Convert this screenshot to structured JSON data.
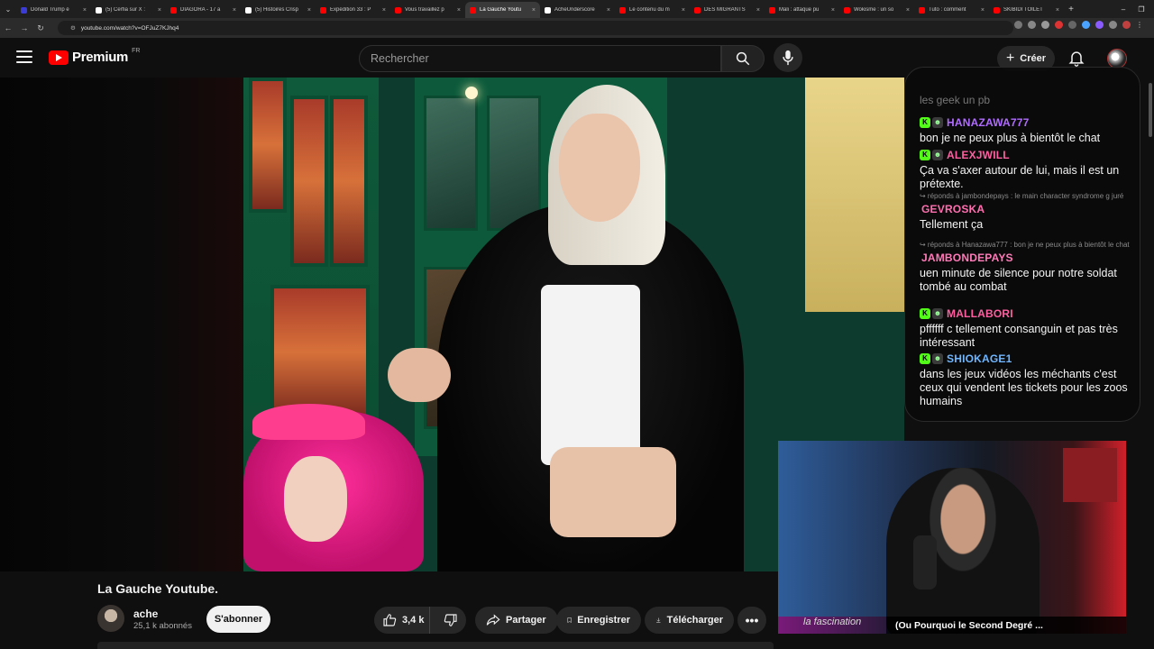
{
  "browser": {
    "tabs": [
      {
        "title": "Donald Trump é",
        "color": "#3b3bd6"
      },
      {
        "title": "(5) Cerfia sur X :",
        "color": "#ffffff"
      },
      {
        "title": "DIAGORA - 17 a",
        "color": "#ff0000"
      },
      {
        "title": "(5) Histoires Crisp",
        "color": "#ffffff"
      },
      {
        "title": "Expédition 33 : P",
        "color": "#ff0000"
      },
      {
        "title": "Vous travaillez p",
        "color": "#ff0000"
      },
      {
        "title": "La Gauche Youtu",
        "color": "#ff0000"
      },
      {
        "title": "AcheUnderscore",
        "color": "#ffffff"
      },
      {
        "title": "Le contenu du m",
        "color": "#ff0000"
      },
      {
        "title": "DES MIGRANTS",
        "color": "#ff0000"
      },
      {
        "title": "Mali : attaque pu",
        "color": "#ff0000"
      },
      {
        "title": "Wokisme : un so",
        "color": "#ff0000"
      },
      {
        "title": "Tuto : comment",
        "color": "#ff0000"
      },
      {
        "title": "SKIBIDI TOILET",
        "color": "#ff0000"
      }
    ],
    "active_tab": 6,
    "url": "youtube.com/watch?v=OFJuZ7KJhq4"
  },
  "header": {
    "logo_text": "Premium",
    "country": "FR",
    "search_placeholder": "Rechercher",
    "create_label": "Créer"
  },
  "chat": {
    "top_fragment": "les geek un pb",
    "messages": [
      {
        "user": "HANAZAWA777",
        "color": "#b06cff",
        "badges": true,
        "reply": "",
        "text": "bon je ne peux plus à bientôt le chat"
      },
      {
        "user": "ALEXJWILL",
        "color": "#ff5fa0",
        "badges": true,
        "reply": "",
        "text": "Ça va s'axer autour de lui, mais il est un prétexte."
      },
      {
        "user": "GEVROSKA",
        "color": "#ff6fb0",
        "badges": false,
        "reply": "↪ réponds à jambondepays : le main character syndrome g juré",
        "text": "Tellement ça"
      },
      {
        "user": "JAMBONDEPAYS",
        "color": "#ff7ab8",
        "badges": false,
        "reply": "↪ réponds à Hanazawa777 : bon je ne peux plus à bientôt le chat",
        "text": "uen minute de silence pour notre soldat tombé au combat"
      },
      {
        "user": "MALLABORI",
        "color": "#ff5fa0",
        "badges": true,
        "reply": "",
        "text": "pffffff c tellement consanguin et pas très intéressant"
      },
      {
        "user": "SHIOKAGE1",
        "color": "#6fb6ff",
        "badges": true,
        "reply": "",
        "text": "dans les jeux vidéos les méchants c'est ceux qui vendent les tickets pour les zoos humains"
      }
    ]
  },
  "webcam": {
    "overlay_left": "la fascination",
    "caption": "(Ou Pourquoi le Second Degré ..."
  },
  "video": {
    "title": "La Gauche Youtube.",
    "channel": "ache",
    "subscribers": "25,1 k abonnés",
    "subscribe_label": "S'abonner",
    "likes": "3,4 k",
    "share_label": "Partager",
    "save_label": "Enregistrer",
    "download_label": "Télécharger"
  }
}
